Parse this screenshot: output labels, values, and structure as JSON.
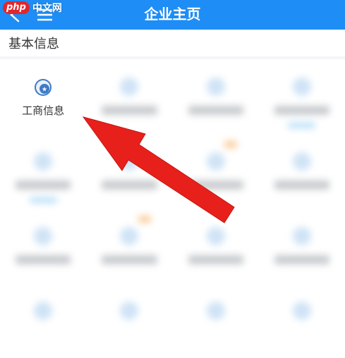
{
  "watermark": {
    "logo": "php",
    "text": "中文网"
  },
  "header": {
    "title": "企业主页"
  },
  "section": {
    "title": "基本信息"
  },
  "grid": {
    "items": [
      {
        "label": "工商信息",
        "icon": "business-info-icon",
        "active": true
      }
    ]
  },
  "colors": {
    "header_bg": "#1e8df5",
    "arrow": "#e8201c"
  }
}
